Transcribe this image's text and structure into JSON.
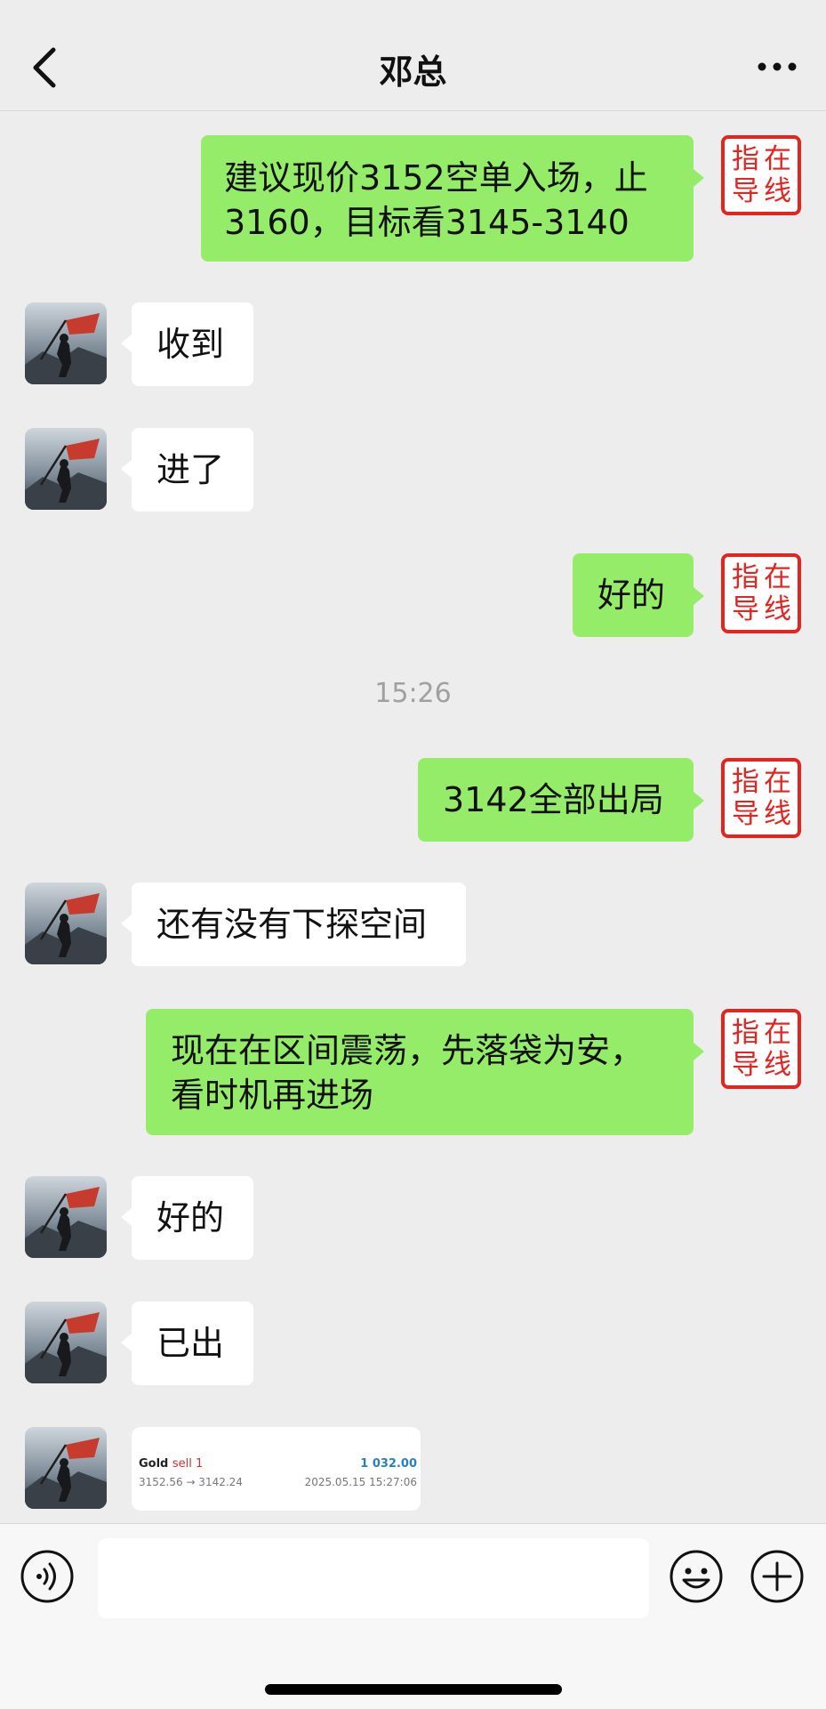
{
  "header": {
    "title": "邓总"
  },
  "seal": {
    "c1": "指",
    "c2": "在",
    "c3": "导",
    "c4": "线"
  },
  "messages": [
    {
      "dir": "out",
      "lines": [
        "建议现价3152空单入场，止",
        "3160，目标看3145-3140"
      ]
    },
    {
      "dir": "in",
      "text": "收到"
    },
    {
      "dir": "in",
      "text": "进了"
    },
    {
      "dir": "out",
      "text": "好的"
    },
    {
      "dir": "out",
      "text": "3142全部出局"
    },
    {
      "dir": "in",
      "text": "还有没有下探空间"
    },
    {
      "dir": "out",
      "lines": [
        "现在在区间震荡，先落袋为安，",
        "看时机再进场"
      ]
    },
    {
      "dir": "in",
      "text": "好的"
    },
    {
      "dir": "in",
      "text": "已出"
    }
  ],
  "timestamp": "15:26",
  "trade_card": {
    "symbol": "Gold",
    "side": "sell 1",
    "profit": "1 032.00",
    "range": "3152.56 → 3142.24",
    "time": "2025.05.15 15:27:06"
  },
  "icons": {
    "back": "chevron-left-icon",
    "more": "more-dots-icon",
    "voice": "voice-icon",
    "emoji": "emoji-icon",
    "plus": "plus-icon"
  },
  "colors": {
    "outgoing": "#95ec69",
    "incoming": "#ffffff",
    "background": "#ededed",
    "seal": "#e3241f"
  }
}
